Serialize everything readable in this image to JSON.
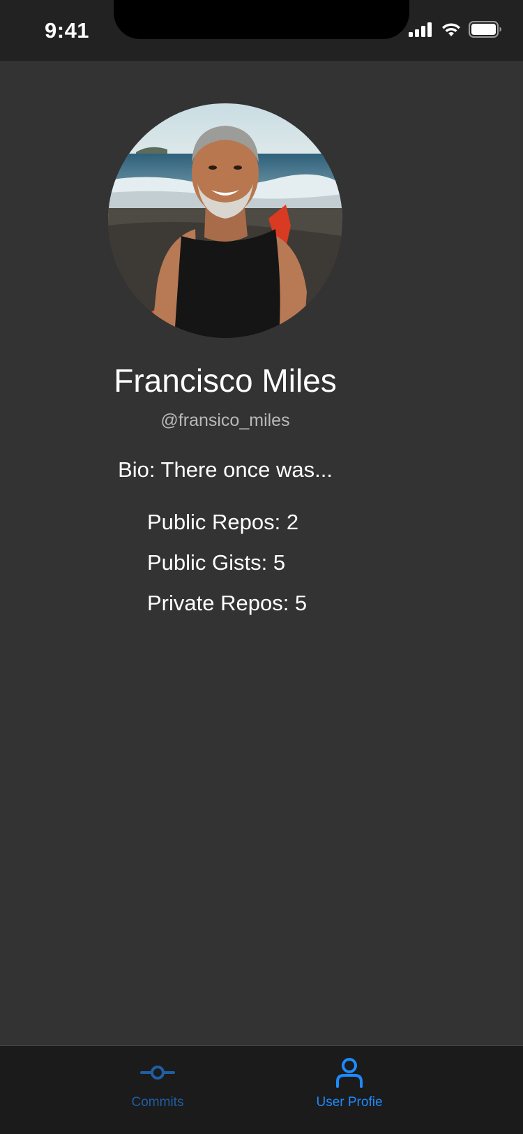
{
  "status_bar": {
    "time": "9:41"
  },
  "profile": {
    "avatar_icon": "user-avatar-photo",
    "name": "Francisco Miles",
    "handle": "@fransico_miles",
    "bio": "Bio: There once was...",
    "stats": {
      "public_repos": "Public Repos: 2",
      "public_gists": "Public Gists: 5",
      "private_repos": "Private Repos: 5"
    }
  },
  "tab_bar": {
    "tabs": [
      {
        "label": "Commits",
        "icon": "commit-icon",
        "selected": false
      },
      {
        "label": "User Profie",
        "icon": "user-icon",
        "selected": true
      }
    ]
  },
  "colors": {
    "background": "#333333",
    "status_bar": "#222222",
    "tab_bar": "#1b1b1b",
    "tab_active": "#1c8bff",
    "tab_inactive": "#1f5ea3",
    "text_primary": "#ffffff",
    "text_secondary": "#b9b9b9"
  }
}
